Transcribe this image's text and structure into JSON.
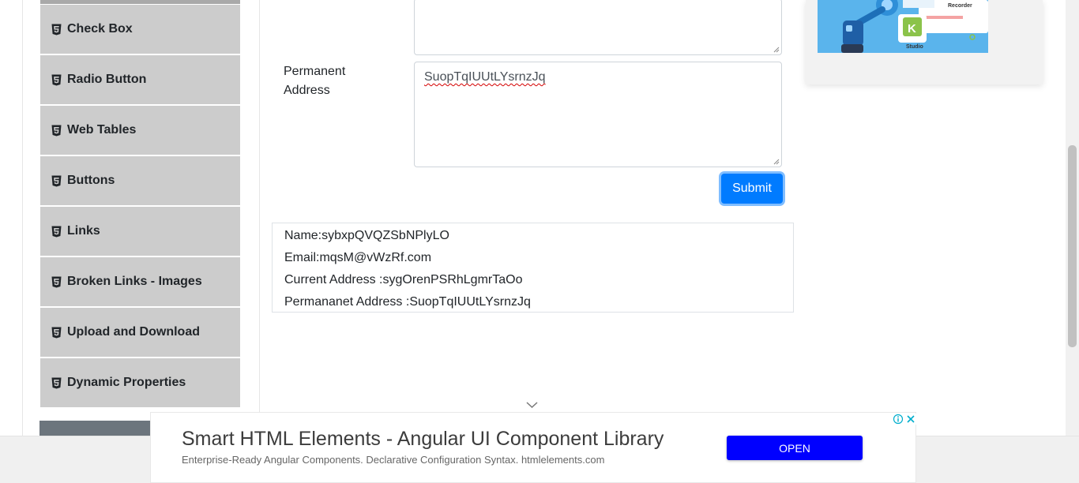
{
  "sidebar": {
    "items": [
      {
        "label": "Check Box",
        "icon": "html5-icon"
      },
      {
        "label": "Radio Button",
        "icon": "html5-icon"
      },
      {
        "label": "Web Tables",
        "icon": "html5-icon"
      },
      {
        "label": "Buttons",
        "icon": "html5-icon"
      },
      {
        "label": "Links",
        "icon": "html5-icon"
      },
      {
        "label": "Broken Links - Images",
        "icon": "html5-icon"
      },
      {
        "label": "Upload and Download",
        "icon": "html5-icon"
      },
      {
        "label": "Dynamic Properties",
        "icon": "html5-icon"
      }
    ]
  },
  "form": {
    "permanent_address_label": "Permanent Address",
    "permanent_address_value": "SuopTqIUUtLYsrnzJq",
    "submit_label": "Submit"
  },
  "output": {
    "name": "Name:sybxpQVQZSbNPlyLO",
    "email": "Email:mqsM@vWzRf.com",
    "current_address": "Current Address :sygOrenPSRhLgmrTaOo",
    "permanent_address": "Permananet Address :SuopTqIUUtLYsrnzJq"
  },
  "side_ad": {
    "text_recorder": "Recorder",
    "text_studio": "Studio",
    "logo_letters": "K"
  },
  "ad_banner": {
    "title": "Smart HTML Elements - Angular UI Component Library",
    "subtitle": "Enterprise-Ready Angular Components. Declarative Configuration Syntax. htmlelements.com",
    "open_label": "OPEN"
  },
  "colors": {
    "primary": "#007bff",
    "sidebar_bg": "#cccccc",
    "ad_button": "#0000ff"
  }
}
